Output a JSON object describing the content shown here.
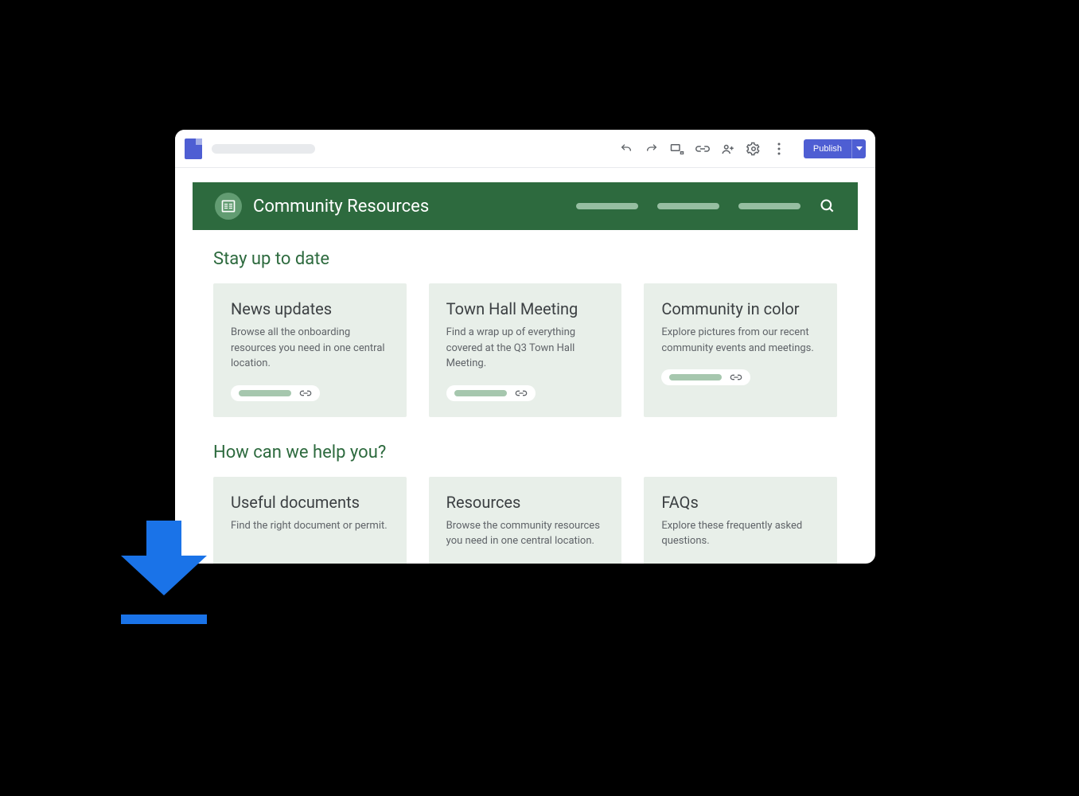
{
  "toolbar": {
    "publish_label": "Publish"
  },
  "site": {
    "title": "Community Resources"
  },
  "sections": {
    "stay": {
      "title": "Stay up to date",
      "cards": [
        {
          "title": "News updates",
          "desc": "Browse all the onboarding resources you need in one central location."
        },
        {
          "title": "Town Hall Meeting",
          "desc": "Find a wrap up of everything covered at the Q3 Town Hall Meeting."
        },
        {
          "title": "Community in color",
          "desc": "Explore pictures from our recent community events and meetings."
        }
      ]
    },
    "help": {
      "title": "How can we help you?",
      "cards": [
        {
          "title": "Useful documents",
          "desc": "Find the right document or permit."
        },
        {
          "title": "Resources",
          "desc": "Browse the community resources you need in one central location."
        },
        {
          "title": "FAQs",
          "desc": "Explore these frequently asked questions."
        }
      ]
    }
  }
}
